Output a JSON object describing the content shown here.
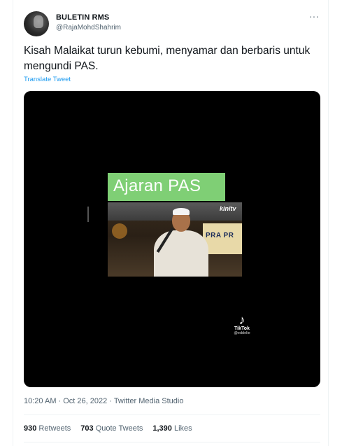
{
  "author": {
    "name": "BULETIN RMS",
    "handle": "@RajaMohdShahrim"
  },
  "tweet": {
    "text": "Kisah Malaikat turun kebumi, menyamar dan berbaris untuk mengundi PAS.",
    "translate_label": "Translate Tweet"
  },
  "media": {
    "overlay_title": "Ajaran PAS",
    "channel_logo": "kinitv",
    "banner_text": "PRA PR",
    "tiktok_label": "TikTok",
    "tiktok_user": "@eddelie"
  },
  "meta": {
    "timestamp": "10:20 AM · Oct 26, 2022 · Twitter Media Studio"
  },
  "stats": {
    "retweets_count": "930",
    "retweets_label": "Retweets",
    "quotes_count": "703",
    "quotes_label": "Quote Tweets",
    "likes_count": "1,390",
    "likes_label": "Likes"
  },
  "icons": {
    "more": "more-horizontal-icon",
    "tiktok": "tiktok-icon"
  },
  "colors": {
    "link": "#1d9bf0",
    "secondary_text": "#536471",
    "overlay_green": "#7fcf75"
  }
}
